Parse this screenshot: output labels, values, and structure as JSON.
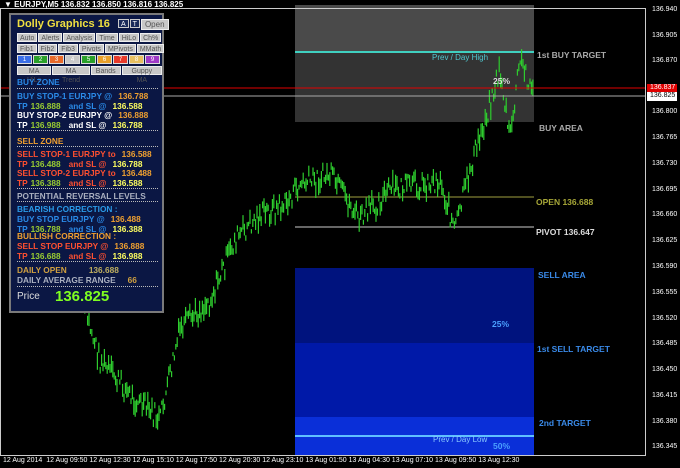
{
  "title_bar": {
    "symbol": "EURJPY,M5",
    "ohlc": "136.832 136.850 136.816 136.825"
  },
  "panel": {
    "title": "Dolly Graphics 16",
    "btn_a": "A",
    "btn_t": "T",
    "btn_open": "Open",
    "row1": [
      "Auto",
      "Alerts",
      "Analysis",
      "Time",
      "HiLo",
      "Ch%"
    ],
    "row2": [
      "Fib1",
      "Fib2",
      "Fib3",
      "Pivots",
      "MPivots",
      "MMath"
    ],
    "colors": [
      {
        "n": "1",
        "c": "#3a6ee8"
      },
      {
        "n": "2",
        "c": "#2aa02a"
      },
      {
        "n": "3",
        "c": "#e86a2a"
      },
      {
        "n": "4",
        "c": "#c8c8c8"
      },
      {
        "n": "5",
        "c": "#2aa02a"
      },
      {
        "n": "6",
        "c": "#e8a02a"
      },
      {
        "n": "7",
        "c": "#e83a2a"
      },
      {
        "n": "8",
        "c": "#e8c060"
      },
      {
        "n": "9",
        "c": "#a03ac8"
      }
    ],
    "row3": [
      "MA HiLo",
      "MA Trend",
      "Bands",
      "Guppy MA"
    ],
    "buy_zone": "BUY ZONE",
    "buy1": {
      "a": "BUY STOP-1  EURJPY  @",
      "p": "136.788",
      "tp": "TP",
      "tpv": "136.888",
      "sl": "and SL @",
      "slv": "136.588"
    },
    "buy2": {
      "a": "BUY STOP-2  EURJPY  @",
      "p": "136.888",
      "tp": "TP",
      "tpv": "136.988",
      "sl": "and SL @",
      "slv": "136.788"
    },
    "sell_zone": "SELL ZONE",
    "sell1": {
      "a": "SELL STOP-1  EURJPY to",
      "p": "136.588",
      "tp": "TP",
      "tpv": "136.488",
      "sl": "and SL @",
      "slv": "136.788"
    },
    "sell2": {
      "a": "SELL STOP-2  EURJPY to",
      "p": "136.488",
      "tp": "TP",
      "tpv": "136.388",
      "sl": "and SL @",
      "slv": "136.588"
    },
    "potential": "POTENTIAL REVERSAL LEVELS",
    "bearish": "BEARISH CORRECTION :",
    "bear": {
      "a": "BUY STOP EURJPY  @",
      "p": "136.488",
      "tp": "TP",
      "tpv": "136.788",
      "sl": "and SL @",
      "slv": "136.388"
    },
    "bullish": "BULLISH CORRECTION :",
    "bull": {
      "a": "SELL STOP EURJPY  @",
      "p": "136.888",
      "tp": "TP",
      "tpv": "136.688",
      "sl": "and SL @",
      "slv": "136.988"
    },
    "daily_open_label": "DAILY OPEN",
    "daily_open": "136.688",
    "dar_label": "DAILY AVERAGE RANGE",
    "dar": "66",
    "price_label": "Price",
    "price": "136.825"
  },
  "chart": {
    "labels": {
      "prev_high": "Prev / Day High",
      "pct25a": "25%",
      "buy_target": "1st BUY TARGET",
      "buy_area": "BUY AREA",
      "open": "OPEN 136.688",
      "pivot": "PIVOT 136.647",
      "sell_area": "SELL AREA",
      "pct25b": "25%",
      "sell_target": "1st SELL TARGET",
      "second_target": "2nd TARGET",
      "prev_low": "Prev / Day Low",
      "pct50": "50%"
    },
    "price_ask": "136.837",
    "price_bid": "136.825",
    "y_ticks": [
      "136.940",
      "136.905",
      "136.870",
      "136.800",
      "136.765",
      "136.730",
      "136.695",
      "136.660",
      "136.625",
      "136.590",
      "136.555",
      "136.520",
      "136.485",
      "136.450",
      "136.415",
      "136.380",
      "136.345"
    ],
    "x_ticks": [
      "12 Aug 2014",
      "12 Aug 09:50",
      "12 Aug 12:30",
      "12 Aug 15:10",
      "12 Aug 17:50",
      "12 Aug 20:30",
      "12 Aug 23:10",
      "13 Aug 01:50",
      "13 Aug 04:30",
      "13 Aug 07:10",
      "13 Aug 09:50",
      "13 Aug 12:30"
    ],
    "colors": {
      "candle": "#2ecc2e",
      "ask": "#e00000",
      "bid": "#ffffff"
    }
  }
}
